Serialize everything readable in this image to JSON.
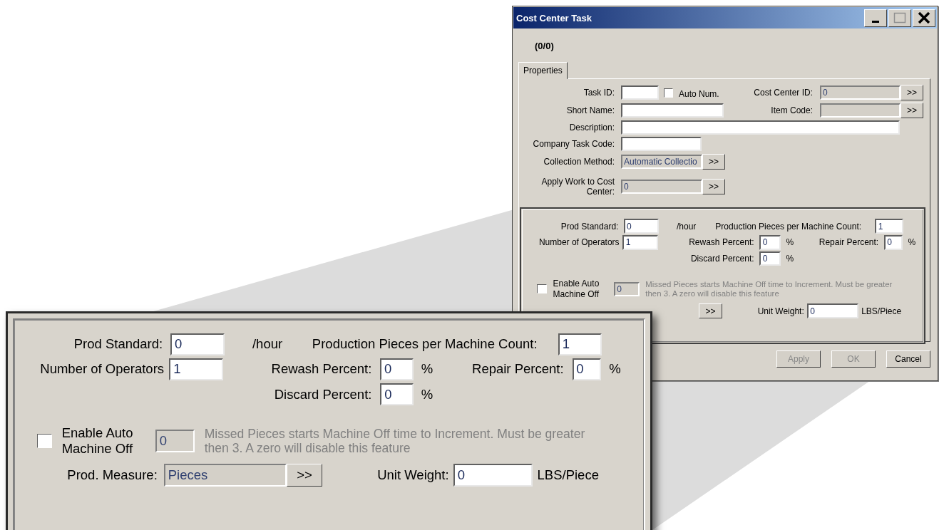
{
  "window": {
    "title": "Cost Center Task"
  },
  "record_counter": "(0/0)",
  "tabs": [
    {
      "label": "Properties",
      "selected": true
    }
  ],
  "properties": {
    "task_id": {
      "label": "Task ID:",
      "disabled": false
    },
    "auto_num": {
      "label": "Auto Num.",
      "checked": false
    },
    "cost_center_id": {
      "label": "Cost Center ID:",
      "value": "0",
      "disabled": true,
      "button": ">>"
    },
    "short_name": {
      "label": "Short Name:",
      "disabled": false
    },
    "item_code": {
      "label": "Item Code:",
      "disabled": true,
      "button": ">>"
    },
    "description": {
      "label": "Description:",
      "disabled": false
    },
    "company_task_code": {
      "label": "Company Task Code:",
      "disabled": false
    },
    "collection_method": {
      "label": "Collection Method:",
      "value": "Automatic  Collectio",
      "disabled": true,
      "button": ">>"
    },
    "apply_work": {
      "label": "Apply Work to Cost Center:",
      "value": "0",
      "disabled": true,
      "button": ">>"
    }
  },
  "production": {
    "prod_standard": {
      "label": "Prod Standard:",
      "value": "0",
      "unit": "/hour",
      "disabled": false
    },
    "pieces_per_count": {
      "label": "Production Pieces per Machine Count:",
      "value": "1",
      "disabled": false
    },
    "operators": {
      "label": "Number of Operators",
      "value": "1",
      "disabled": false
    },
    "rewash": {
      "label": "Rewash Percent:",
      "value": "0",
      "unit": "%",
      "disabled": false
    },
    "repair": {
      "label": "Repair Percent:",
      "value": "0",
      "unit": "%",
      "disabled": false
    },
    "discard": {
      "label": "Discard Percent:",
      "value": "0",
      "unit": "%",
      "disabled": false
    },
    "auto_machine_off": {
      "label": "Enable Auto Machine Off",
      "checked": false,
      "value": "0",
      "disabled": true,
      "note": "Missed Pieces starts Machine Off time to Increment. Must be greater then 3. A zero will disable this feature"
    },
    "prod_measure": {
      "button": ">>"
    },
    "unit_weight": {
      "label": "Unit Weight:",
      "value": "0",
      "unit": "LBS/Piece",
      "disabled": false
    }
  },
  "buttons": [
    {
      "label": "Apply",
      "disabled": true
    },
    {
      "label": "OK",
      "disabled": true
    },
    {
      "label": "Cancel",
      "disabled": false
    }
  ],
  "callout": {
    "prod_standard": {
      "label": "Prod Standard:",
      "value": "0",
      "unit": "/hour",
      "disabled": false
    },
    "pieces_per_count": {
      "label": "Production Pieces per Machine Count:",
      "value": "1",
      "disabled": false
    },
    "operators": {
      "label": "Number of Operators",
      "value": "1",
      "disabled": false
    },
    "rewash": {
      "label": "Rewash Percent:",
      "value": "0",
      "unit": "%",
      "disabled": false
    },
    "repair": {
      "label": "Repair Percent:",
      "value": "0",
      "unit": "%",
      "disabled": false
    },
    "discard": {
      "label": "Discard Percent:",
      "value": "0",
      "unit": "%",
      "disabled": false
    },
    "auto_machine_off": {
      "label": "Enable Auto Machine Off",
      "checked": false,
      "value": "0",
      "disabled": true,
      "note": "Missed Pieces starts Machine Off time to Increment. Must be greater then 3. A zero will disable this feature"
    },
    "prod_measure": {
      "label": "Prod. Measure:",
      "value": "Pieces",
      "disabled": true,
      "button": ">>"
    },
    "unit_weight": {
      "label": "Unit Weight:",
      "value": "0",
      "unit": "LBS/Piece",
      "disabled": false
    }
  }
}
